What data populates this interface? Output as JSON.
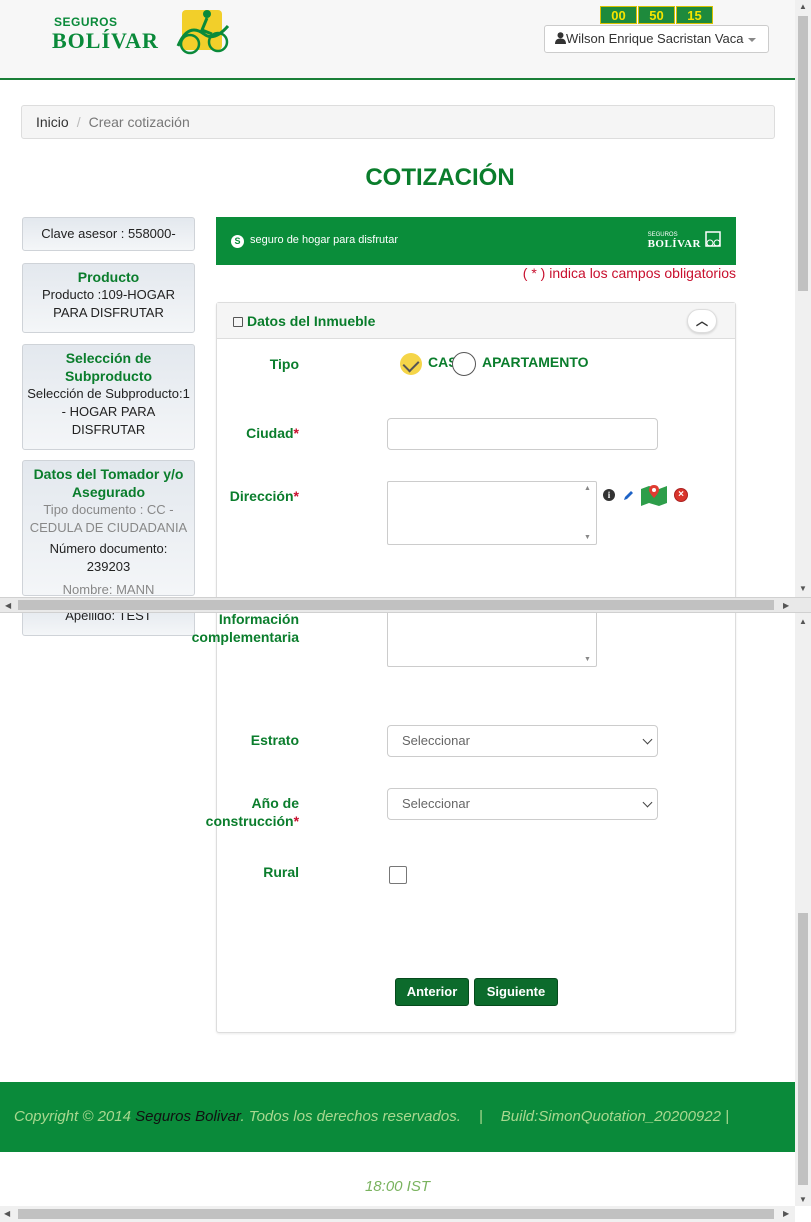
{
  "header": {
    "logo_top": "SEGUROS",
    "logo_main": "BOLÍVAR",
    "timer": [
      "00",
      "50",
      "15"
    ],
    "user_name": "Wilson Enrique Sacristan Vaca"
  },
  "breadcrumb": {
    "home": "Inicio",
    "separator": "/",
    "current": "Crear cotización"
  },
  "page_title": "COTIZACIÓN",
  "sidebar": {
    "clave": "Clave asesor : 558000-",
    "producto_title": "Producto",
    "producto_text": "Producto :109-HOGAR PARA DISFRUTAR",
    "subproducto_title": "Selección de Subproducto",
    "subproducto_text": "Selección de Subproducto:1 - HOGAR PARA DISFRUTAR",
    "tomador_title": "Datos del Tomador y/o Asegurado",
    "tipo_doc": "Tipo documento : CC - CEDULA DE CIUDADANIA",
    "numero_doc": "Número documento: 239203",
    "nombre": "Nombre: MANN",
    "apellido": "Apellido: TEST"
  },
  "banner": {
    "circle": "S",
    "text": "seguro de hogar para disfrutar",
    "logo_top": "SEGUROS",
    "logo_main": "BOLÍVAR"
  },
  "required_note": "( * ) indica los campos obligatorios",
  "panel": {
    "title": "Datos del Inmueble",
    "tipo_label": "Tipo",
    "option_casa": "CASA",
    "option_apartamento": "APARTAMENTO",
    "ciudad_label": "Ciudad",
    "direccion_label": "Dirección",
    "info_label": "Información complementaria",
    "estrato_label": "Estrato",
    "estrato_value": "Seleccionar",
    "anio_label": "Año de construcción",
    "anio_value": "Seleccionar",
    "rural_label": "Rural",
    "required_mark": "*",
    "prev_button": "Anterior",
    "next_button": "Siguiente"
  },
  "footer": {
    "copyright": "Copyright © 2014",
    "brand": "Seguros Bolivar",
    "rights": ". Todos los derechos reservados.",
    "pipe": "|",
    "build": "Build:SimonQuotation_20200922 |"
  },
  "time": "18:00 IST",
  "colors": {
    "brand_green": "#0a8a3a",
    "title_green": "#0a7d2c",
    "required_red": "#c8102e",
    "timer_yellow": "#f5e400"
  }
}
